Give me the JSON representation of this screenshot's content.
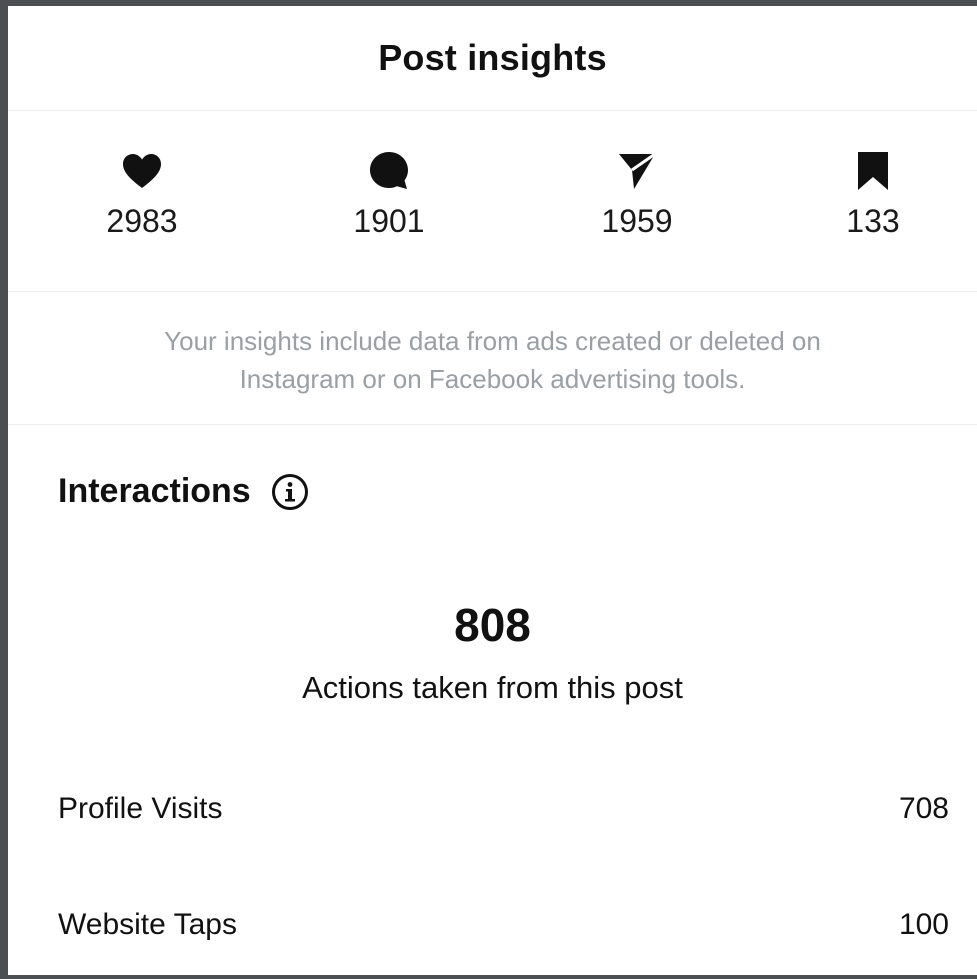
{
  "header": {
    "title": "Post insights"
  },
  "stats": [
    {
      "icon": "heart-icon",
      "value": "2983"
    },
    {
      "icon": "comment-icon",
      "value": "1901"
    },
    {
      "icon": "share-icon",
      "value": "1959"
    },
    {
      "icon": "bookmark-icon",
      "value": "133"
    }
  ],
  "notice": {
    "line1": "Your insights include data from ads created or deleted on",
    "line2": "Instagram or on Facebook advertising tools."
  },
  "interactions": {
    "title": "Interactions",
    "info_icon": "info-icon",
    "total": "808",
    "caption": "Actions taken from this post",
    "rows": [
      {
        "label": "Profile Visits",
        "value": "708"
      },
      {
        "label": "Website Taps",
        "value": "100"
      }
    ]
  },
  "colors": {
    "text_primary": "#111111",
    "text_muted": "#9a9fa3",
    "frame_border": "#4b4f52",
    "background": "#ffffff"
  }
}
